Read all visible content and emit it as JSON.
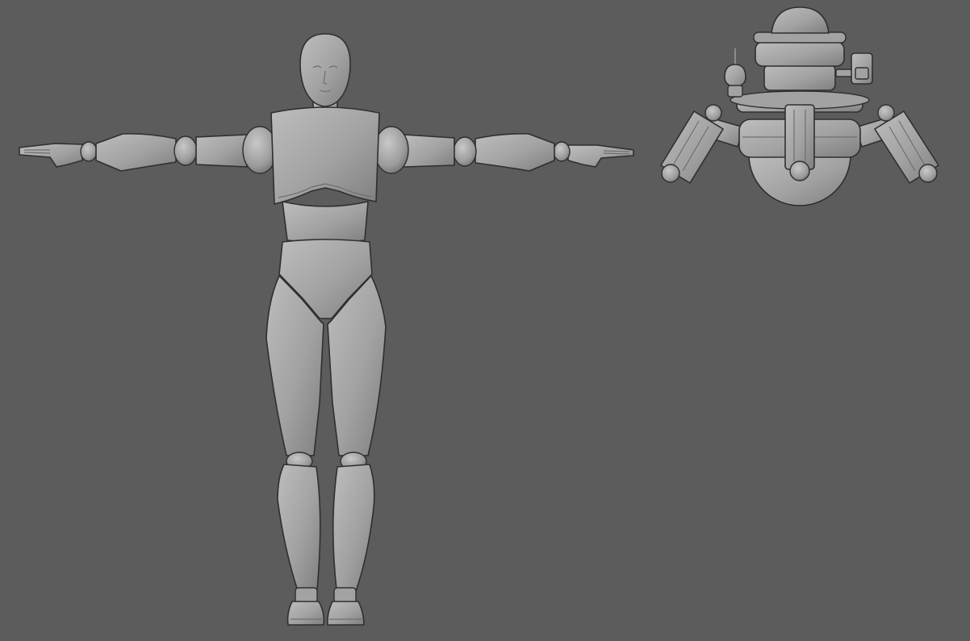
{
  "viewport": {
    "background": "#5c5c5c"
  },
  "colors": {
    "shade_light": "#bdbdbd",
    "shade_mid": "#a2a2a2",
    "shade_dark": "#7f7f7f",
    "outline": "#2f2f2f"
  },
  "models": [
    {
      "kind": "humanoid-mannequin",
      "pose": "t-pose"
    },
    {
      "kind": "hover-drone-robot"
    }
  ]
}
